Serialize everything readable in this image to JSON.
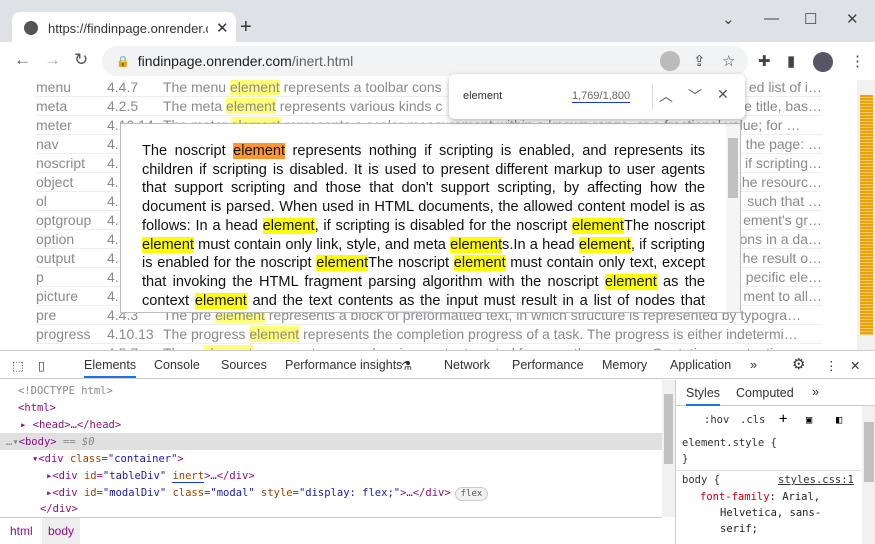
{
  "browser": {
    "tab_title": "https://findinpage.onrender.com/",
    "url_host": "findinpage.onrender.com",
    "url_path": "/inert.html"
  },
  "table_rows": [
    {
      "name": "menu",
      "section": "4.4.7",
      "pre": "The menu ",
      "hl": "element",
      "post": " represents a toolbar cons",
      "right": "ed list of i…"
    },
    {
      "name": "meta",
      "section": "4.2.5",
      "pre": "The meta ",
      "hl": "element",
      "post": " represents various kinds c",
      "right": "e title, bas…"
    },
    {
      "name": "meter",
      "section": "4.10.14",
      "pre": "The meter ",
      "hl": "element",
      "post": " represents a scalar measurement within a known range, or a fractional value; for …",
      "right": ""
    },
    {
      "name": "nav",
      "section": "4.",
      "pre": "",
      "hl": "",
      "post": "",
      "right": "the page: …"
    },
    {
      "name": "noscript",
      "section": "4.",
      "pre": "",
      "hl": "",
      "post": "",
      "right": "if scripting…"
    },
    {
      "name": "object",
      "section": "4.",
      "pre": "",
      "hl": "",
      "post": "",
      "right": "he resourc…"
    },
    {
      "name": "ol",
      "section": "4.",
      "pre": "",
      "hl": "",
      "post": "",
      "right": "such that …"
    },
    {
      "name": "optgroup",
      "section": "4.",
      "pre": "",
      "hl": "",
      "post": "",
      "right": "ement's gr…"
    },
    {
      "name": "option",
      "section": "4.",
      "pre": "",
      "hl": "",
      "post": "",
      "right": "ons in a da…"
    },
    {
      "name": "output",
      "section": "4.",
      "pre": "",
      "hl": "",
      "post": "",
      "right": "he result o…"
    },
    {
      "name": "p",
      "section": "4.",
      "pre": "",
      "hl": "",
      "post": "",
      "right": "pecific ele…"
    },
    {
      "name": "picture",
      "section": "4.",
      "pre": "",
      "hl": "",
      "post": "",
      "right": "ment to all…"
    },
    {
      "name": "pre",
      "section": "4.4.3",
      "pre": "The pre ",
      "hl": "element",
      "post": " represents a block of preformatted text, in which structure is represented by typogra…",
      "right": ""
    },
    {
      "name": "progress",
      "section": "4.10.13",
      "pre": "The progress ",
      "hl": "element",
      "post": " represents the completion progress of a task. The progress is either indetermi…",
      "right": ""
    },
    {
      "name": "q",
      "section": "4.5.7",
      "pre": "The q ",
      "hl": "element",
      "post": " represents some phrasing content quoted from another source. Quotation punctuatio…",
      "right": ""
    }
  ],
  "modal_segments": [
    {
      "t": "The noscript "
    },
    {
      "t": "element",
      "h": "current"
    },
    {
      "t": " represents nothing if scripting is enabled, and represents its children if scripting is disabled. It is used to present different markup to user agents that support scripting and those that don't support scripting, by affecting how the document is parsed. When used in HTML documents, the allowed content model is as follows: In a head "
    },
    {
      "t": "element",
      "h": "match"
    },
    {
      "t": ", if scripting is disabled for the noscript "
    },
    {
      "t": "element",
      "h": "match"
    },
    {
      "t": "The noscript "
    },
    {
      "t": "element",
      "h": "match"
    },
    {
      "t": " must contain only link, style, and meta "
    },
    {
      "t": "element",
      "h": "match"
    },
    {
      "t": "s.In a head "
    },
    {
      "t": "element",
      "h": "match"
    },
    {
      "t": ", if scripting is enabled for the noscript "
    },
    {
      "t": "element",
      "h": "match"
    },
    {
      "t": "The noscript "
    },
    {
      "t": "element",
      "h": "match"
    },
    {
      "t": " must contain only text, except that invoking the HTML fragment parsing algorithm with the noscript "
    },
    {
      "t": "element",
      "h": "match"
    },
    {
      "t": " as the context "
    },
    {
      "t": "element",
      "h": "match"
    },
    {
      "t": " and the text contents as the input must result in a list of nodes that consists only of link, style, and meta "
    },
    {
      "t": "element",
      "h": "match"
    },
    {
      "t": "s that would be conforming if they were"
    }
  ],
  "find": {
    "query": "element",
    "count": "1,769/1,800"
  },
  "devtools": {
    "tabs": [
      "Elements",
      "Console",
      "Sources",
      "Performance insights",
      "Network",
      "Performance",
      "Memory",
      "Application"
    ],
    "dom": {
      "doctype": "<!DOCTYPE html>",
      "html": "<html>",
      "head": "<head>…</head>",
      "body": "<body>",
      "body_eq": " == $0",
      "container_open": "<div ",
      "container_attr": "class",
      "container_val": "\"container\"",
      "tablediv_open": "<div ",
      "tablediv_attr": "id",
      "tablediv_val": "\"tableDiv\"",
      "tablediv_inert": "inert",
      "tablediv_close": ">…</div>",
      "modal_open": "<div ",
      "modal_id_attr": "id",
      "modal_id_val": "\"modalDiv\"",
      "modal_class_attr": "class",
      "modal_class_val": "\"modal\"",
      "modal_style_attr": "style",
      "modal_style_val": "\"display: flex;\"",
      "modal_close": ">…</div>",
      "flex_badge": "flex",
      "div_close": "</div>"
    },
    "breadcrumb": [
      "html",
      "body"
    ],
    "styles_tabs": [
      "Styles",
      "Computed"
    ],
    "styles": {
      "hov": ":hov",
      "cls": ".cls",
      "element_style": "element.style {",
      "close": "}",
      "body_sel": "body {",
      "source": "styles.css:1",
      "prop": "font-family",
      "value1": ": Arial,",
      "value2": "Helvetica, sans-",
      "value3": "serif;"
    }
  },
  "colors": {
    "match": "#ffff00",
    "current": "#ff9632",
    "accent": "#1a73e8"
  }
}
